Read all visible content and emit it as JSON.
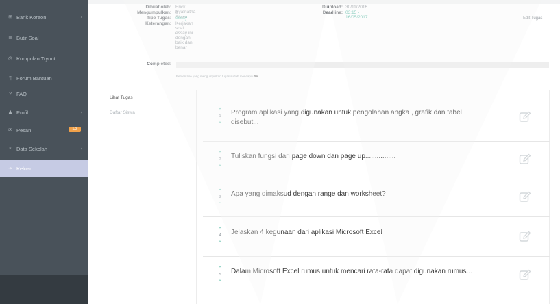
{
  "sidebar": {
    "items": [
      {
        "label": "Bank Koreon",
        "icon": "⊞",
        "icon_name": "grid-icon",
        "chevron": "‹"
      },
      {
        "label": "Butir Soal",
        "icon": "≣",
        "icon_name": "list-icon",
        "chevron": ""
      },
      {
        "label": "Kumpulan Tryout",
        "icon": "◷",
        "icon_name": "clock-icon",
        "chevron": ""
      },
      {
        "label": "Forum Bantuan",
        "icon": "¶",
        "icon_name": "forum-icon",
        "chevron": ""
      },
      {
        "label": "FAQ",
        "icon": "?",
        "icon_name": "question-icon",
        "chevron": ""
      },
      {
        "label": "Profil",
        "icon": "♟",
        "icon_name": "user-icon",
        "chevron": "‹"
      },
      {
        "label": "Pesan",
        "icon": "✉",
        "icon_name": "envelope-icon",
        "chevron": "",
        "badge": "1/3"
      },
      {
        "label": "Data Sekolah",
        "icon": "⌕",
        "icon_name": "search-icon",
        "chevron": "‹"
      },
      {
        "label": "Keluar",
        "icon": "⇥",
        "icon_name": "logout-icon",
        "chevron": "",
        "active": true
      }
    ]
  },
  "info": {
    "dibuat_label": "Dibuat oleh:",
    "dibuat_value": "Erick Syafriatha",
    "mengumpulkan_label": "Mengumpulkan:",
    "mengumpulkan_value": "0 Siswa",
    "tipe_label": "Tipe Tugas:",
    "tipe_value": "essay",
    "keterangan_label": "Keterangan:",
    "keterangan_value": "Kerjakan soal essay ini dengan baik dan benar",
    "diupload_label": "Diupload:",
    "diupload_value": "30/11/2016",
    "deadline_label": "Deadline:",
    "deadline_value": "03:15 - 16/05/2017",
    "completed_label": "Completed:",
    "edit_label": "Edit Tugas"
  },
  "progress": {
    "percent": 0,
    "note_prefix": "Persentase yang mengumpulkan tugas sudah mencapai",
    "note_value": "0%"
  },
  "tabs": [
    {
      "label": "Lihat Tugas"
    },
    {
      "label": "Daftar Siswa"
    }
  ],
  "questions": [
    {
      "num": "1",
      "text": "Program aplikasi yang digunakan untuk pengolahan angka , grafik dan tabel disebut..."
    },
    {
      "num": "2",
      "text": "Tuliskan fungsi dari page down dan page up................"
    },
    {
      "num": "3",
      "text": "Apa yang dimaksud dengan range dan worksheet?"
    },
    {
      "num": "4",
      "text": "Jelaskan 4 kegunaan dari aplikasi  Microsoft Excel"
    },
    {
      "num": "5",
      "text": "Dalam Microsoft Excel rumus untuk mencari rata-rata dapat digunakan rumus..."
    }
  ]
}
